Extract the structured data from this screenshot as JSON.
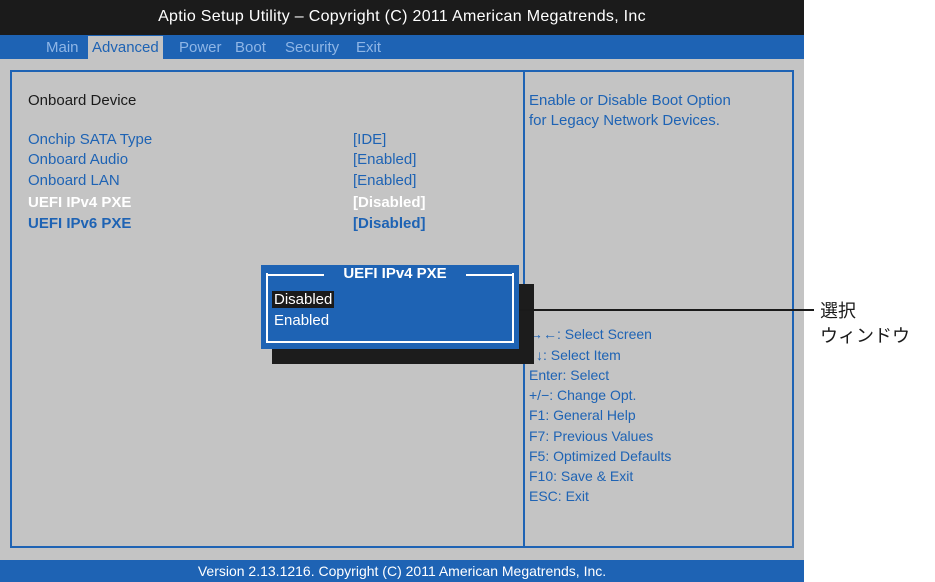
{
  "title": "Aptio Setup Utility – Copyright (C) 2011 American Megatrends, Inc",
  "tabs": [
    "Main",
    "Advanced",
    "Power",
    "Boot",
    "Security",
    "Exit"
  ],
  "active_tab": "Advanced",
  "section_heading": "Onboard Device",
  "settings": [
    {
      "label": "Onchip SATA Type",
      "value": "[IDE]"
    },
    {
      "label": "Onboard Audio",
      "value": "[Enabled]"
    },
    {
      "label": "Onboard LAN",
      "value": "[Enabled]"
    },
    {
      "label": "UEFI IPv4 PXE",
      "value": "[Disabled]"
    },
    {
      "label": "UEFI IPv6 PXE",
      "value": "[Disabled]"
    }
  ],
  "help": [
    "Enable or Disable Boot Option",
    "for Legacy Network Devices."
  ],
  "popup": {
    "title": "UEFI IPv4 PXE",
    "options": [
      "Disabled",
      "Enabled"
    ],
    "selected": "Disabled"
  },
  "keys": [
    "→←: Select Screen",
    "↑↓: Select Item",
    "Enter: Select",
    "+/−: Change Opt.",
    "F1: General Help",
    "F7: Previous Values",
    "F5: Optimized Defaults",
    "F10: Save & Exit",
    "ESC: Exit"
  ],
  "footer": "Version 2.13.1216. Copyright (C) 2011 American Megatrends, Inc.",
  "callout": [
    "選択",
    "ウィンドウ"
  ]
}
